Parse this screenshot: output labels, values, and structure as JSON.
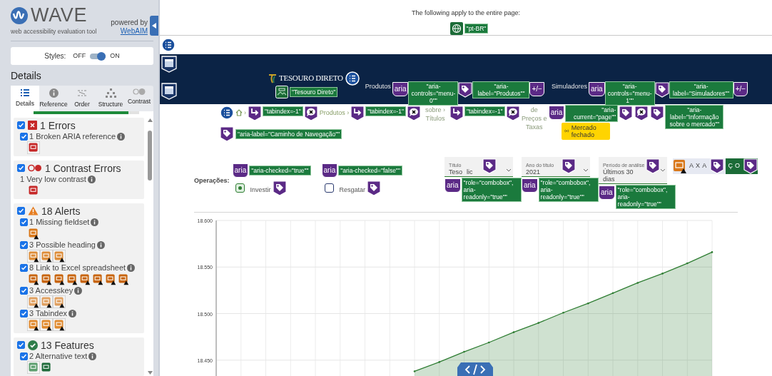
{
  "sidebar": {
    "brand": "WAVE",
    "tagline": "web accessibility evaluation tool",
    "powered_by": "powered by",
    "powered_link": "WebAIM",
    "styles": {
      "label": "Styles:",
      "off_label": "OFF",
      "on_label": "ON",
      "on": true
    },
    "heading": "Details",
    "tabs": [
      {
        "label": "Details",
        "kind": "details",
        "selected": true
      },
      {
        "label": "Reference",
        "kind": "reference",
        "selected": false
      },
      {
        "label": "Order",
        "kind": "order",
        "selected": false
      },
      {
        "label": "Structure",
        "kind": "structure",
        "selected": false
      },
      {
        "label": "Contrast",
        "kind": "contrast",
        "selected": false
      }
    ],
    "progress": {
      "level": 0.9
    },
    "categories": [
      {
        "kind": "error",
        "title": "1 Errors",
        "checked": true,
        "items": [
          {
            "label": "1 Broken ARIA reference",
            "checked": true,
            "markers": [
              {
                "kind": "broken-aria"
              }
            ]
          }
        ]
      },
      {
        "kind": "contrast",
        "title": "1 Contrast Errors",
        "checked": true,
        "items": [
          {
            "label": "1 Very low contrast",
            "markers": [
              {
                "kind": "contrast"
              }
            ]
          }
        ]
      },
      {
        "kind": "alert",
        "title": "18 Alerts",
        "checked": true,
        "items": [
          {
            "label": "1 Missing fieldset",
            "checked": true,
            "markers": [
              {
                "kind": "fieldset"
              }
            ]
          },
          {
            "label": "3 Possible heading",
            "checked": true,
            "markers": [
              {
                "kind": "heading"
              },
              {
                "kind": "heading"
              },
              {
                "kind": "heading"
              }
            ]
          },
          {
            "label": "8 Link to Excel spreadsheet",
            "checked": true,
            "markers": [
              {
                "kind": "excel"
              },
              {
                "kind": "excel"
              },
              {
                "kind": "excel"
              },
              {
                "kind": "excel"
              },
              {
                "kind": "excel"
              },
              {
                "kind": "excel"
              },
              {
                "kind": "excel"
              },
              {
                "kind": "excel"
              }
            ]
          },
          {
            "label": "3 Accesskey",
            "checked": true,
            "markers": [
              {
                "kind": "accesskey"
              },
              {
                "kind": "accesskey"
              },
              {
                "kind": "accesskey"
              }
            ]
          },
          {
            "label": "3 Tabindex",
            "checked": true,
            "markers": [
              {
                "kind": "tabindex"
              },
              {
                "kind": "tabindex"
              },
              {
                "kind": "tabindex"
              }
            ]
          }
        ]
      },
      {
        "kind": "feature",
        "title": "13 Features",
        "checked": true,
        "items": [
          {
            "label": "2 Alternative text",
            "checked": true,
            "markers": [
              {
                "kind": "alt-light"
              },
              {
                "kind": "alt-dark"
              }
            ]
          }
        ]
      }
    ]
  },
  "notice": {
    "text": "The following apply to the entire page:",
    "language": "\"pt-BR\""
  },
  "header": {
    "logo": "TESOURO DIRETO",
    "logo_alt": "\"Tesouro Direto\"",
    "nav": [
      {
        "label": "Produtos",
        "badge": "aria",
        "controls": "\"aria-controls=\"menu-0\"\"",
        "aria_label": "\"aria-label=\"Produtos\"\"",
        "expand": "+/−"
      },
      {
        "label": "Simuladores",
        "badge": "aria",
        "controls": "\"aria-controls=\"menu-1\"\"",
        "aria_label": "\"aria-label=\"Simuladores\"\"",
        "expand": "+/−"
      }
    ]
  },
  "breadcrumb": [
    {
      "kind": "list"
    },
    {
      "kind": "home"
    },
    {
      "kind": "text",
      "text": "›"
    },
    {
      "kind": "tabindex"
    },
    {
      "kind": "chip",
      "text": "\"tabindex=-1\""
    },
    {
      "kind": "x-bubble"
    },
    {
      "kind": "text",
      "text": "Produtos ›"
    },
    {
      "kind": "tabindex"
    },
    {
      "kind": "chip",
      "text": "\"tabindex=-1\""
    },
    {
      "kind": "x-bubble"
    },
    {
      "kind": "stacked-text",
      "text": "sobre › Títulos"
    },
    {
      "kind": "tabindex"
    },
    {
      "kind": "chip",
      "text": "\"tabindex=-1\""
    },
    {
      "kind": "x-bubble"
    },
    {
      "kind": "stacked-text",
      "text": "de Preços e Taxas"
    },
    {
      "kind": "aria",
      "text": "aria"
    },
    {
      "kind": "status",
      "chip": "\"aria-current=\"page\"\"",
      "text": "Mercado fechado"
    },
    {
      "kind": "tag"
    },
    {
      "kind": "x-bubble"
    },
    {
      "kind": "tag"
    },
    {
      "kind": "wide-chip",
      "text": "\"aria-label=\"Informação sobre o mercado\"\""
    }
  ],
  "nav_label": "\"aria-label=\"Caminho de Navegação\"\"",
  "operations": {
    "label": "Operações:",
    "options": [
      {
        "badge": "aria",
        "chip": "\"aria-checked=\"true\"\"",
        "label": "Investir",
        "selected": true
      },
      {
        "badge": "aria",
        "chip": "\"aria-checked=\"false\"\"",
        "label": "Resgatar",
        "selected": false
      }
    ],
    "selects": [
      {
        "label": "Título",
        "value_parts": [
          "Teso",
          "lic"
        ],
        "badge": "aria",
        "chip": "\"role=\"combobox\", aria-readonly=\"true\"\""
      },
      {
        "label": "Ano do título",
        "value_parts": [
          "2021"
        ],
        "badge": "aria",
        "chip": "\"role=\"combobox\", aria-readonly=\"true\"\""
      },
      {
        "label": "Período de análise",
        "value_parts": [
          "Últimos 30 dias"
        ],
        "badge": "aria",
        "chip": "\"role=\"combobox\", aria-readonly=\"true\"\""
      }
    ],
    "rate_tabs": [
      "AXA",
      "ÇO"
    ]
  },
  "chart_data": {
    "type": "area",
    "ylim": [
      18.433,
      18.6
    ],
    "grid": true,
    "yticks": [
      {
        "value": 18.45,
        "label": "18.450"
      },
      {
        "value": 18.5,
        "label": "18.500"
      },
      {
        "value": 18.55,
        "label": "18.550"
      },
      {
        "value": 18.6,
        "label": "18.600"
      }
    ],
    "series": [
      {
        "color": "#2e7d32",
        "values": [
          null,
          null,
          null,
          null,
          null,
          null,
          null,
          null,
          18.438,
          18.448,
          18.459,
          18.469,
          18.48,
          18.49,
          18.501,
          18.511,
          18.522,
          18.533,
          18.543,
          18.554,
          18.566
        ]
      }
    ]
  }
}
